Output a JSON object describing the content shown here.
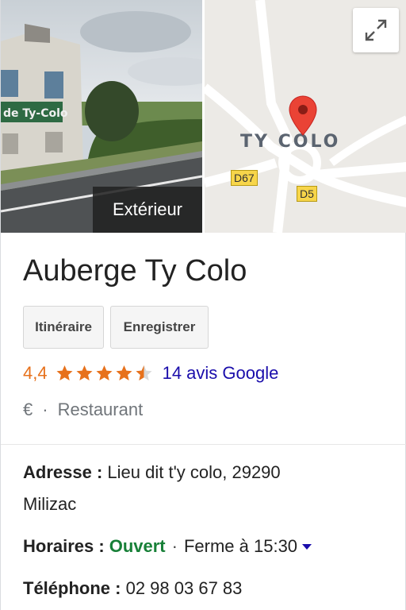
{
  "media": {
    "photo_label": "Extérieur",
    "photo_sign_text": "de Ty-Colo",
    "map_label": "TY COLO",
    "roads": [
      "D67",
      "D5"
    ]
  },
  "place": {
    "name": "Auberge Ty Colo",
    "actions": {
      "directions": "Itinéraire",
      "save": "Enregistrer"
    },
    "rating": {
      "value": "4,4",
      "stars": 4.4,
      "reviews": "14 avis Google"
    },
    "price": "€",
    "separator": "·",
    "category": "Restaurant"
  },
  "details": {
    "address_label": "Adresse :",
    "address_line1": "Lieu dit t'y colo, 29290",
    "address_line2": "Milizac",
    "hours_label": "Horaires :",
    "hours_status": "Ouvert",
    "hours_sep": "·",
    "hours_close": "Ferme à 15:30",
    "phone_label": "Téléphone :",
    "phone": "02 98 03 67 83"
  },
  "colors": {
    "rating": "#e7711b",
    "link": "#1a0dab",
    "open": "#188038",
    "map_pin": "#ea4335"
  },
  "icons": {
    "expand": "expand-icon",
    "pin": "map-pin-icon",
    "star": "star-icon",
    "dropdown": "caret-down-icon"
  }
}
